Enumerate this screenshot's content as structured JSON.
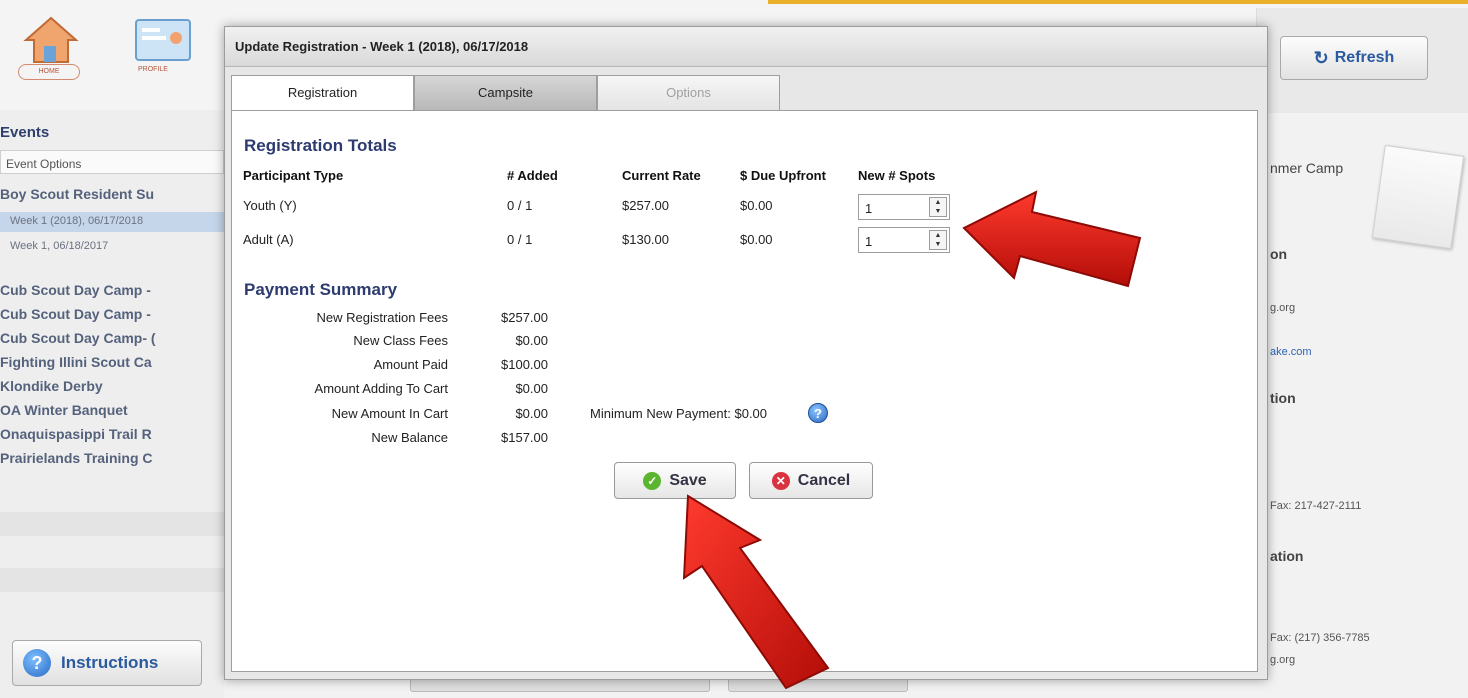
{
  "background": {
    "nav": {
      "home_label": "HOME",
      "profile_label": "PROFILE"
    },
    "refresh_label": "Refresh",
    "events_title": "Events",
    "event_options_label": "Event Options",
    "events": [
      "Boy Scout Resident Su",
      "Week 1 (2018), 06/17/2018",
      "Week 1, 06/18/2017",
      "Cub Scout Day Camp -",
      "Cub Scout Day Camp -",
      "Cub Scout Day Camp- (",
      "Fighting Illini Scout Ca",
      "Klondike Derby",
      "OA Winter Banquet",
      "Onaquispasippi Trail R",
      "Prairielands Training C"
    ],
    "instructions_label": "Instructions",
    "right_texts": {
      "camp_title": "nmer Camp",
      "section1": "on",
      "email1": "g.org",
      "link1": "ake.com",
      "section2": "tion",
      "fax1": "Fax: 217-427-2111",
      "section3": "ation",
      "fax2": "Fax: (217) 356-7785",
      "email2": "g.org"
    }
  },
  "modal": {
    "title": "Update Registration - Week 1 (2018), 06/17/2018",
    "tabs": [
      {
        "label": "Registration",
        "state": "active"
      },
      {
        "label": "Campsite",
        "state": "normal"
      },
      {
        "label": "Options",
        "state": "disabled"
      }
    ],
    "registration_totals": {
      "heading": "Registration Totals",
      "columns": [
        "Participant Type",
        "# Added",
        "Current Rate",
        "$ Due Upfront",
        "New # Spots"
      ],
      "rows": [
        {
          "type": "Youth (Y)",
          "added": "0 / 1",
          "rate": "$257.00",
          "due": "$0.00",
          "spots": "1"
        },
        {
          "type": "Adult (A)",
          "added": "0 / 1",
          "rate": "$130.00",
          "due": "$0.00",
          "spots": "1"
        }
      ]
    },
    "payment_summary": {
      "heading": "Payment Summary",
      "rows": [
        {
          "label": "New Registration Fees",
          "value": "$257.00"
        },
        {
          "label": "New Class Fees",
          "value": "$0.00"
        },
        {
          "label": "Amount Paid",
          "value": "$100.00"
        },
        {
          "label": "Amount Adding To Cart",
          "value": "$0.00"
        },
        {
          "label": "New Amount In Cart",
          "value": "$0.00"
        },
        {
          "label": "New Balance",
          "value": "$157.00"
        }
      ],
      "minimum_payment": "Minimum New Payment: $0.00"
    },
    "save_label": "Save",
    "cancel_label": "Cancel"
  },
  "colors": {
    "heading": "#2d3b6f",
    "accent_gold": "#e8b02a",
    "arrow_red": "#e11a14",
    "save_icon": "#5cb531",
    "cancel_icon": "#d9333f"
  },
  "icons": [
    "home-icon",
    "profile-icon",
    "refresh-icon",
    "help-icon",
    "check-icon",
    "close-icon",
    "question-icon"
  ]
}
